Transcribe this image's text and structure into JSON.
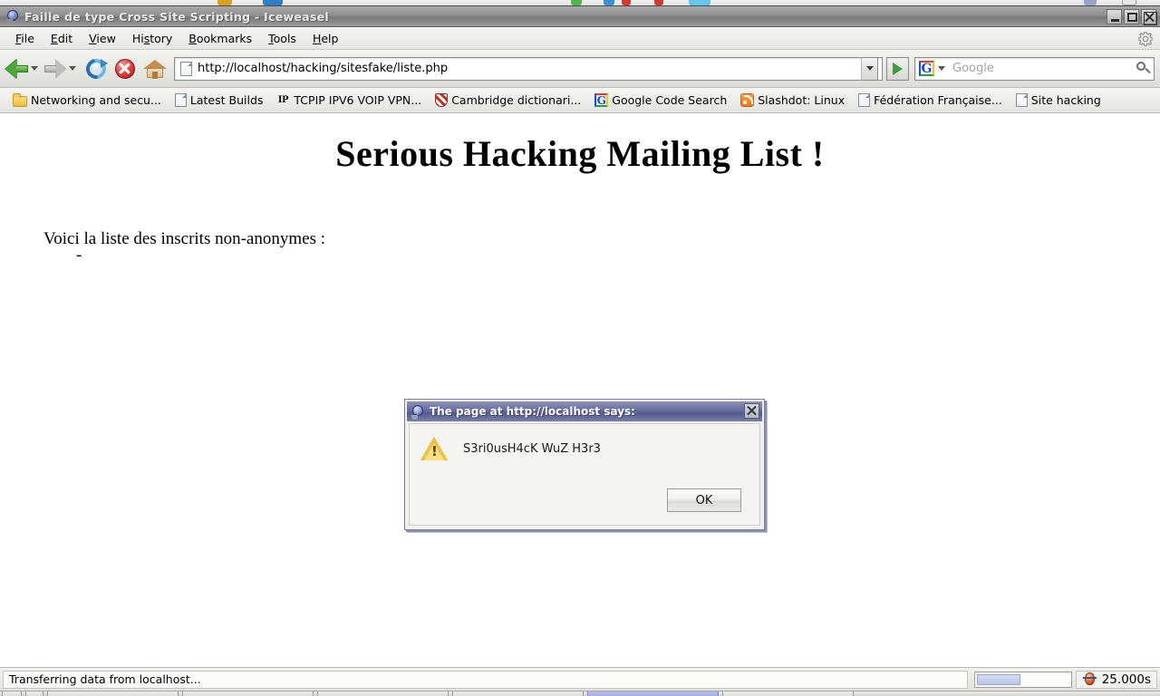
{
  "window": {
    "title": "Faille de type Cross Site Scripting - Iceweasel",
    "icon": "iceweasel-globe-icon",
    "controls": {
      "minimize": "–",
      "maximize": "□",
      "close": "✕"
    }
  },
  "menubar": {
    "items": [
      {
        "label": "File",
        "accel": "F"
      },
      {
        "label": "Edit",
        "accel": "E"
      },
      {
        "label": "View",
        "accel": "V"
      },
      {
        "label": "History",
        "accel": "s"
      },
      {
        "label": "Bookmarks",
        "accel": "B"
      },
      {
        "label": "Tools",
        "accel": "T"
      },
      {
        "label": "Help",
        "accel": "H"
      }
    ]
  },
  "toolbar": {
    "back": "Back",
    "forward": "Forward",
    "reload": "Reload",
    "stop": "Stop",
    "home": "Home",
    "url": "http://localhost/hacking/sitesfake/liste.php",
    "go": "Go",
    "search_engine": "G",
    "search_placeholder": "Google",
    "search_value": ""
  },
  "bookmarks": {
    "items": [
      {
        "label": "Networking and secu...",
        "icon": "folder-icon"
      },
      {
        "label": "Latest Builds",
        "icon": "document-icon"
      },
      {
        "label": "TCPIP IPV6 VOIP VPN...",
        "icon": "ip-icon"
      },
      {
        "label": "Cambridge dictionari...",
        "icon": "shield-icon"
      },
      {
        "label": "Google Code Search",
        "icon": "google-icon"
      },
      {
        "label": "Slashdot: Linux",
        "icon": "rss-icon"
      },
      {
        "label": "Fédération Française...",
        "icon": "document-icon"
      },
      {
        "label": "Site hacking",
        "icon": "document-icon"
      }
    ]
  },
  "page": {
    "heading": "Serious Hacking Mailing List !",
    "intro": "Voici la liste des inscrits non-anonymes :",
    "list_marker": "-"
  },
  "dialog": {
    "title": "The page at http://localhost says:",
    "icon": "iceweasel-globe-icon",
    "alert_icon": "warning-triangle-icon",
    "message": "S3ri0usH4cK WuZ H3r3",
    "ok_label": "OK",
    "close_label": "✕"
  },
  "statusbar": {
    "text": "Transferring data from localhost...",
    "progress_percent": 47,
    "timer": "25.000s",
    "timer_icon": "firebug-icon"
  },
  "colors": {
    "titlebar": "#8f8f8f",
    "dialog_titlebar": "#6c72a0",
    "accent_green": "#51a53c",
    "stop_red": "#d93b3b",
    "warning_yellow": "#f0c040",
    "page_bg": "#ffffff"
  }
}
